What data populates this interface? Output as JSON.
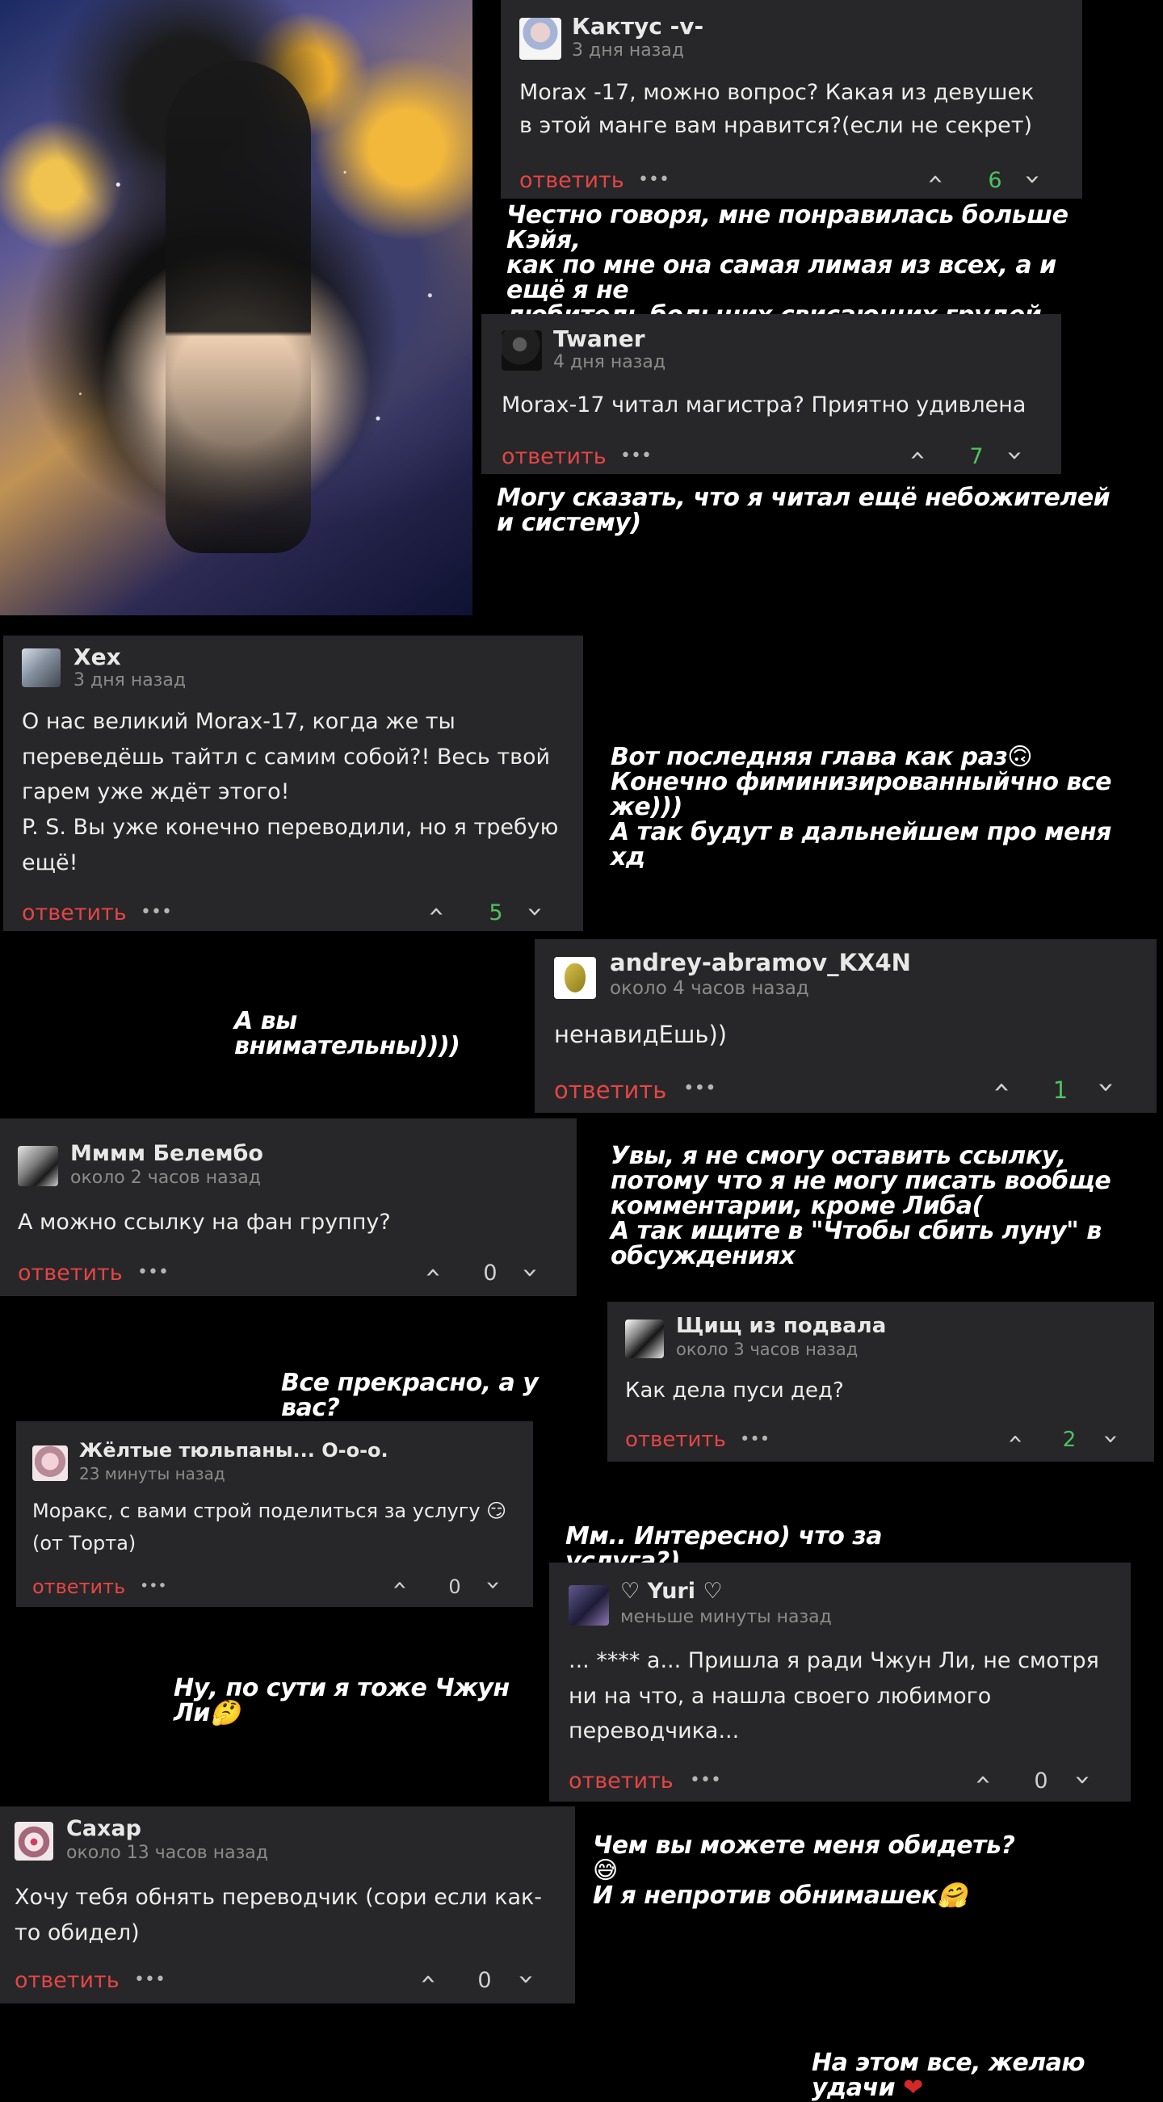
{
  "ui": {
    "reply": "ответить",
    "more": "•••"
  },
  "comments": [
    {
      "author": "Кактус -v-",
      "time": "3 дня назад",
      "text": "Morax -17, можно вопрос? Какая из девушек в этой манге вам нравится?(если не секрет)",
      "votes": "6"
    },
    {
      "author": "Twaner",
      "time": "4 дня назад",
      "text": "Morax-17 читал магистра? Приятно удивлена",
      "votes": "7"
    },
    {
      "author": "Хех",
      "time": "3 дня назад",
      "text": "О нас великий Morax-17, когда же ты переведёшь тайтл с самим собой?! Весь твой гарем уже ждёт этого!\nP. S. Вы уже конечно переводили, но я требую ещё!",
      "votes": "5"
    },
    {
      "author": "andrey-abramov_KX4N",
      "time": "около 4 часов назад",
      "text": "ненавидЕшь))",
      "votes": "1"
    },
    {
      "author": "Мммм Белембо",
      "time": "около 2 часов назад",
      "text": "А можно ссылку на фан группу?",
      "votes": "0"
    },
    {
      "author": "Щищ из подвала",
      "time": "около 3 часов назад",
      "text": "Как дела пуси дед?",
      "votes": "2"
    },
    {
      "author": "Жёлтые тюльпаны... О-о-о.",
      "time": "23 минуты назад",
      "text": "Моракс, с вами строй поделиться за услугу 😏\n(от Торта)",
      "votes": "0"
    },
    {
      "author": "♡ Yuri ♡",
      "time": "меньше минуты назад",
      "text": "... **** а... Пришла я ради Чжун Ли, не смотря ни на что, а нашла своего любимого переводчика...",
      "votes": "0"
    },
    {
      "author": "Сахар",
      "time": "около 13 часов назад",
      "text": "Хочу тебя обнять переводчик (сори если как-то обидел)",
      "votes": "0"
    }
  ],
  "notes": [
    "Честно говоря, мне понравилась больше Кэйя,\nкак по мне она самая лимая из всех, а и ещё я не\nлюбитель больших свисающих грудей, поэтому\nЧжун улетел в сторону 😅",
    "Могу сказать, что я читал ещё небожителей и систему)",
    "Вот последняя глава как раз🙃\nКонечно фиминизированныйчно все же)))\nА так будут в дальнейшем про меня хд",
    "А вы внимательны))))",
    "Увы, я не смогу оставить ссылку,\nпотому что я не могу писать вообще\nкомментарии, кроме Либа(\nА так ищите в \"Чтобы сбить луну\" в\nобсуждениях",
    "Все прекрасно, а у вас?",
    "Мм.. Интересно) что за услуга?)",
    "Ну, по сути я тоже Чжун Ли🤔",
    "Чем вы можете меня обидеть? 😅\nИ я непротив обнимашек🤗",
    "На этом все, желаю удачи"
  ],
  "colors": {
    "reply": "#e54545",
    "positive": "#4fc25f",
    "card": "#272729"
  }
}
